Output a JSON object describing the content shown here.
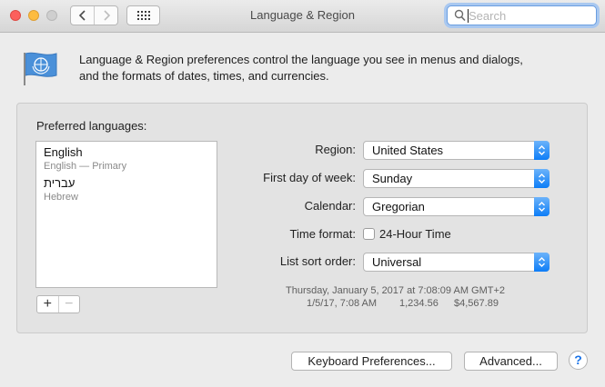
{
  "window": {
    "title": "Language & Region"
  },
  "search": {
    "placeholder": "Search",
    "value": ""
  },
  "header": {
    "description_line1": "Language & Region preferences control the language you see in menus and dialogs,",
    "description_line2": "and the formats of dates, times, and currencies."
  },
  "languages": {
    "label": "Preferred languages:",
    "items": [
      {
        "name": "English",
        "subtitle": "English — Primary"
      },
      {
        "name": "עברית",
        "subtitle": "Hebrew"
      }
    ],
    "add_label": "+",
    "remove_label": "−"
  },
  "settings": {
    "region_label": "Region:",
    "region_value": "United States",
    "first_day_label": "First day of week:",
    "first_day_value": "Sunday",
    "calendar_label": "Calendar:",
    "calendar_value": "Gregorian",
    "time_format_label": "Time format:",
    "time_format_checkbox": "24-Hour Time",
    "time_format_checked": false,
    "sort_order_label": "List sort order:",
    "sort_order_value": "Universal"
  },
  "sample": {
    "datetime": "Thursday, January 5, 2017 at 7:08:09 AM GMT+2",
    "short_date": "1/5/17, 7:08 AM",
    "number": "1,234.56",
    "currency": "$4,567.89"
  },
  "buttons": {
    "keyboard": "Keyboard Preferences...",
    "advanced": "Advanced...",
    "help": "?"
  },
  "colors": {
    "accent": "#0d7df7",
    "close": "#fc605c",
    "minimize": "#fdbc40",
    "flag": "#4a90d9"
  }
}
